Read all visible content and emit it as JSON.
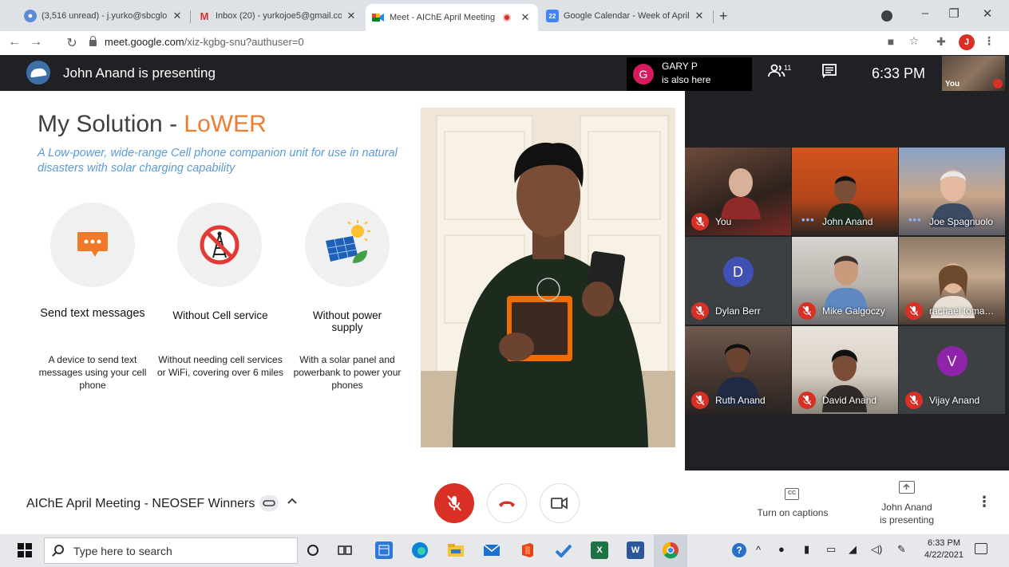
{
  "browser": {
    "tabs": [
      {
        "title": "(3,516 unread) - j.yurko@sbcglob",
        "favicon": "yahoo-mail-icon",
        "active": false
      },
      {
        "title": "Inbox (20) - yurkojoe5@gmail.co",
        "favicon": "gmail-icon",
        "active": false
      },
      {
        "title": "Meet - AIChE April Meeting",
        "favicon": "google-meet-icon",
        "active": true,
        "recording": true
      },
      {
        "title": "Google Calendar - Week of April",
        "favicon": "google-calendar-icon",
        "active": false
      }
    ],
    "url_host": "meet.google.com",
    "url_path": "/xiz-kgbg-snu?authuser=0",
    "profile_initial": "J"
  },
  "meet": {
    "presenting_banner": "John Anand is presenting",
    "also_here": {
      "initial": "G",
      "name": "GARY P",
      "note": "is also here",
      "avatar_color": "#d81b60"
    },
    "participant_count": "11",
    "time": "6:33 PM",
    "self_thumb_label": "You",
    "meeting_name": "AIChE April Meeting - NEOSEF Winners",
    "captions_label": "Turn on captions",
    "present_label_line1": "John Anand",
    "present_label_line2": "is presenting"
  },
  "slide": {
    "title_prefix": "My Solution - ",
    "title_accent": "LoWER",
    "subtitle": "A Low-power, wide-range Cell phone companion unit for use in natural disasters with solar charging capability",
    "features": [
      {
        "title": "Send text messages",
        "desc": "A device to send text messages using your cell phone",
        "icon": "chat-bubble-icon"
      },
      {
        "title": "Without Cell service",
        "desc": "Without needing cell services or WiFi, covering over 6 miles",
        "icon": "no-cell-tower-icon"
      },
      {
        "title": "Without power supply",
        "desc": "With a solar panel and powerbank to power your phones",
        "icon": "solar-panel-icon"
      }
    ]
  },
  "participants": [
    {
      "name": "You",
      "muted": true,
      "speaking": false
    },
    {
      "name": "John Anand",
      "muted": false,
      "speaking": true
    },
    {
      "name": "Joe Spagnuolo",
      "muted": false,
      "speaking": true
    },
    {
      "name": "Dylan Berr",
      "muted": true,
      "initial": "D",
      "avatar_color": "#3f51b5"
    },
    {
      "name": "Mike Galgoczy",
      "muted": true
    },
    {
      "name": "rachael toma…",
      "muted": true
    },
    {
      "name": "Ruth Anand",
      "muted": true
    },
    {
      "name": "David Anand",
      "muted": true
    },
    {
      "name": "Vijay Anand",
      "muted": true,
      "initial": "V",
      "avatar_color": "#8e24aa"
    }
  ],
  "taskbar": {
    "search_placeholder": "Type here to search",
    "time": "6:33 PM",
    "date": "4/22/2021"
  },
  "colors": {
    "meet_dark": "#202124",
    "end_call_red": "#d93025",
    "slide_accent": "#ed7d31",
    "slide_subtitle": "#5b9bd5"
  }
}
